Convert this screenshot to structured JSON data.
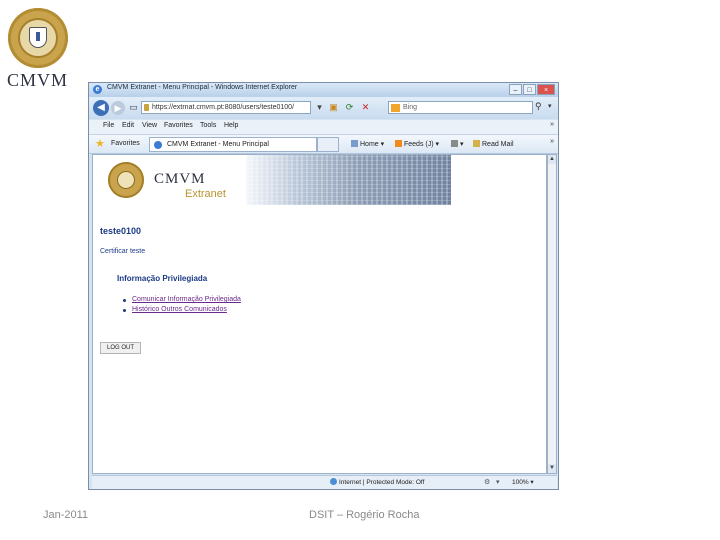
{
  "slide": {
    "logo_text": "CMVM",
    "footer_left": "Jan-2011",
    "footer_center": "DSIT – Rogério Rocha"
  },
  "browser": {
    "title": "CMVM Extranet - Menu Principal - Windows Internet Explorer",
    "address": "https://extrnat.cmvm.pt:8080/users/teste0100/",
    "search_placeholder": "Bing",
    "menu": [
      "File",
      "Edit",
      "View",
      "Favorites",
      "Tools",
      "Help"
    ],
    "favorites_label": "Favorites",
    "tab_title": "CMVM Extranet - Menu Principal",
    "toolbar": {
      "home": "Home",
      "feeds": "Feeds (J)",
      "read_mail": "Read Mail"
    },
    "status": {
      "zone": "Internet | Protected Mode: Off",
      "zoom": "100%"
    }
  },
  "page": {
    "banner": {
      "brand": "CMVM",
      "product": "Extranet"
    },
    "username": "teste0100",
    "certificate_link": "Certificar teste",
    "section_title": "Informação Privilegiada",
    "links": [
      "Comunicar Informação Privilegiada",
      "Histórico Outros Comunicados"
    ],
    "logout_label": "LOG OUT"
  },
  "colors": {
    "accent_gold": "#c9a44c",
    "link_blue": "#1c3a86",
    "visited_link": "#6a2a8a",
    "ie_chrome": "#d6e4f2"
  },
  "icons": [
    "cmvm-seal-icon",
    "back-icon",
    "forward-icon",
    "lock-icon",
    "refresh-icon",
    "stop-icon",
    "search-icon",
    "star-icon",
    "home-icon",
    "feeds-icon",
    "print-icon",
    "mail-icon",
    "globe-icon"
  ]
}
